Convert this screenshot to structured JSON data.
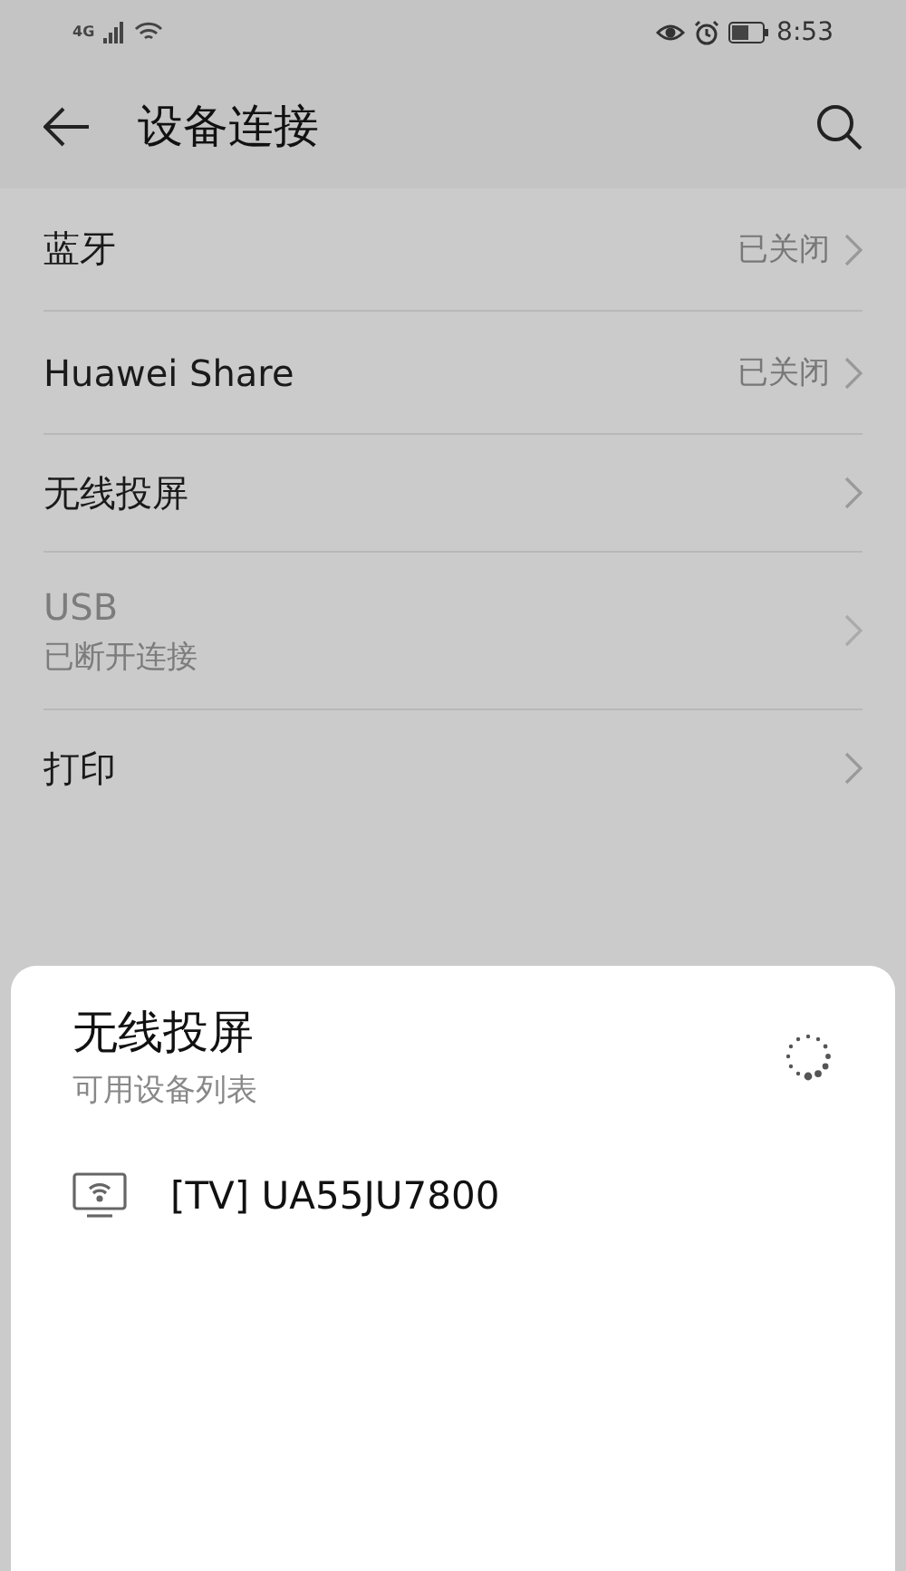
{
  "status_bar": {
    "network": "4G",
    "time": "8:53"
  },
  "header": {
    "title": "设备连接"
  },
  "items": [
    {
      "label": "蓝牙",
      "value": "已关闭",
      "disabled": false
    },
    {
      "label": "Huawei Share",
      "value": "已关闭",
      "disabled": false
    },
    {
      "label": "无线投屏",
      "disabled": false
    },
    {
      "label": "USB",
      "subtitle": "已断开连接",
      "disabled": true
    },
    {
      "label": "打印",
      "disabled": false
    }
  ],
  "sheet": {
    "title": "无线投屏",
    "subtitle": "可用设备列表",
    "devices": [
      {
        "name": "[TV] UA55JU7800"
      }
    ]
  }
}
